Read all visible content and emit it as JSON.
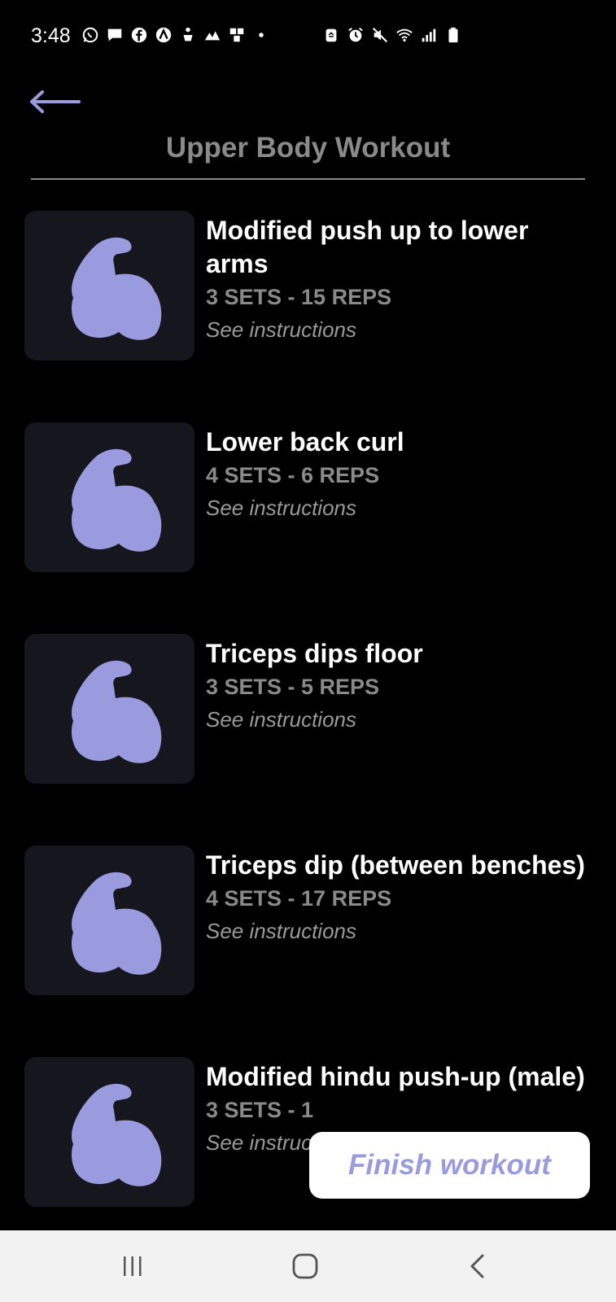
{
  "status_bar": {
    "time": "3:48",
    "left_icons": [
      "whatsapp-icon",
      "chat-bubble-icon",
      "facebook-icon",
      "arc-app-icon",
      "person-cart-icon",
      "hills-icon",
      "pinwheel-icon",
      "dot-icon"
    ],
    "right_icons": [
      "battery-saver-icon",
      "alarm-icon",
      "mute-icon",
      "wifi-icon",
      "signal-icon",
      "battery-icon"
    ]
  },
  "header": {
    "back_icon": "arrow-left-icon",
    "title": "Upper Body Workout"
  },
  "exercises": [
    {
      "name": "Modified push up to lower arms",
      "sets": "3 SETS - 15 REPS",
      "instructions_label": "See instructions",
      "icon": "flexed-bicep-icon"
    },
    {
      "name": "Lower back curl",
      "sets": "4 SETS - 6 REPS",
      "instructions_label": "See instructions",
      "icon": "flexed-bicep-icon"
    },
    {
      "name": "Triceps dips floor",
      "sets": "3 SETS - 5 REPS",
      "instructions_label": "See instructions",
      "icon": "flexed-bicep-icon"
    },
    {
      "name": "Triceps dip (between benches)",
      "sets": "4 SETS - 17 REPS",
      "instructions_label": "See instructions",
      "icon": "flexed-bicep-icon"
    },
    {
      "name": "Modified hindu push-up (male)",
      "sets": "3 SETS - 1",
      "instructions_label": "See instructions",
      "icon": "flexed-bicep-icon"
    }
  ],
  "finish_button": {
    "label": "Finish workout"
  },
  "nav_bar": {
    "recents_icon": "recents-icon",
    "home_icon": "home-icon",
    "back_icon": "chevron-left-icon"
  },
  "colors": {
    "background": "#000000",
    "accent": "#9a9ade",
    "thumb_bg": "#16161f",
    "muted_text": "#8a8a8a",
    "nav_bg": "#f2f2f2"
  }
}
